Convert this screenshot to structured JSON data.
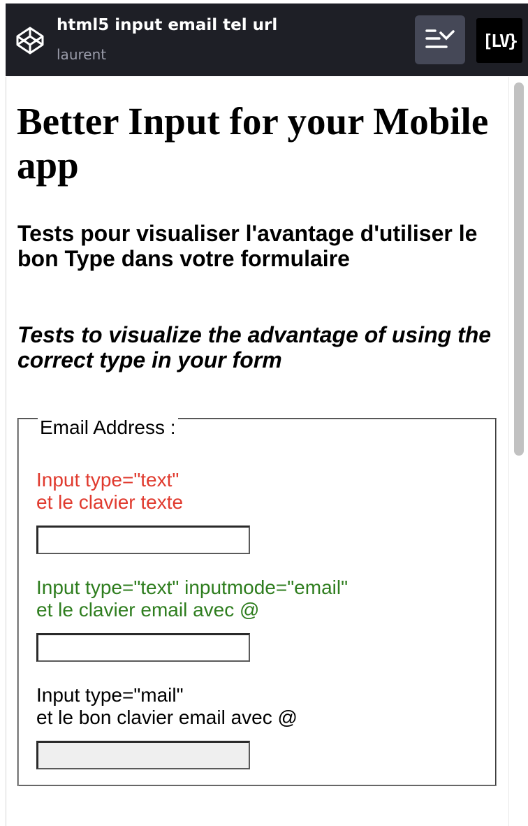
{
  "header": {
    "pen_title": "html5 input email tel url",
    "author": "laurent",
    "logo_icon": "codepen-cube-icon",
    "view_toggle_icon": "change-view-icon",
    "badge_text": "[LV}"
  },
  "page": {
    "title": "Better Input for your Mobile app",
    "subtitle_fr": "Tests pour visualiser l'avantage d'utiliser le bon Type dans votre formulaire",
    "subtitle_en": "Tests to visualize the advantage of using the correct type in your form"
  },
  "fieldset": {
    "legend": "Email Address :",
    "fields": [
      {
        "line1": "Input type=\"text\"",
        "line2": "et le clavier texte",
        "color": "#e03a2e",
        "value": ""
      },
      {
        "line1": "Input type=\"text\" inputmode=\"email\"",
        "line2": "et le clavier email avec @",
        "color": "#2e7d1e",
        "value": ""
      },
      {
        "line1": "Input type=\"mail\"",
        "line2": "et le bon clavier email avec @",
        "color": "#000000",
        "value": ""
      }
    ]
  },
  "colors": {
    "header_bg": "#1e1f26",
    "view_button_bg": "#454857",
    "author_text": "#9a9caa"
  }
}
